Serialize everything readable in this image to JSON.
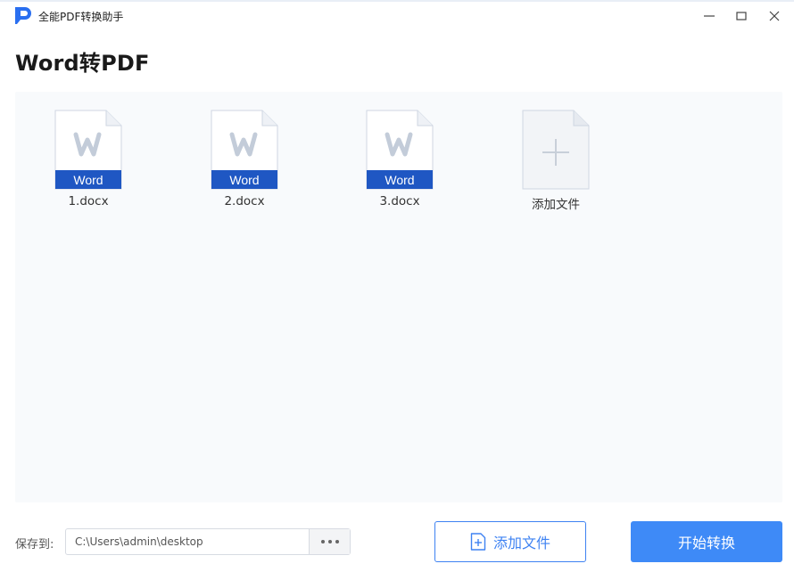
{
  "window": {
    "title": "全能PDF转换助手"
  },
  "page": {
    "title": "Word转PDF"
  },
  "files": [
    {
      "name": "1.docx",
      "type_label": "Word"
    },
    {
      "name": "2.docx",
      "type_label": "Word"
    },
    {
      "name": "3.docx",
      "type_label": "Word"
    }
  ],
  "add_tile": {
    "label": "添加文件"
  },
  "bottom": {
    "save_label": "保存到:",
    "path_value": "C:\\Users\\admin\\desktop",
    "add_button_label": "添加文件",
    "start_button_label": "开始转换"
  },
  "colors": {
    "accent": "#3e8af7",
    "word_badge": "#1f57c3",
    "file_area_bg": "#f8fafc"
  },
  "icons": {
    "logo": "app-logo-p",
    "minimize": "minimize-icon",
    "maximize": "maximize-icon",
    "close": "close-icon",
    "browse": "more-dots-icon",
    "add_file": "file-plus-icon"
  }
}
